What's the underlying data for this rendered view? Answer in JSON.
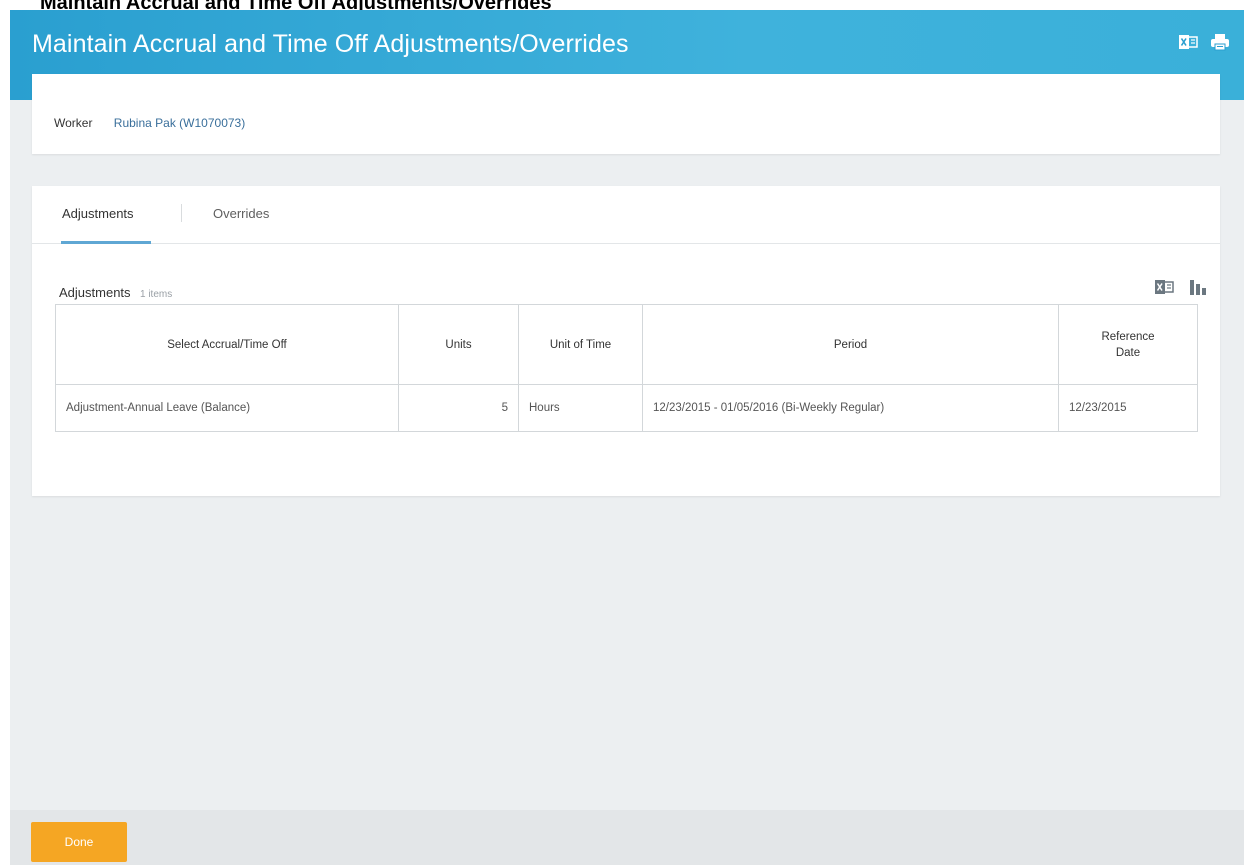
{
  "caption": "Maintain Accrual and Time Off Adjustments/Overrides",
  "header": {
    "title": "Maintain Accrual and Time Off Adjustments/Overrides",
    "icons": [
      "excel-export-icon",
      "print-icon"
    ],
    "band_color": "#3aaed9"
  },
  "worker": {
    "label": "Worker",
    "value": "Rubina Pak (W1070073)"
  },
  "tabs": [
    {
      "label": "Adjustments",
      "active": true
    },
    {
      "label": "Overrides",
      "active": false
    }
  ],
  "adjustments": {
    "title": "Adjustments",
    "count": "1 items",
    "tools": [
      "excel-export-icon",
      "chart-view-icon"
    ],
    "columns": [
      "Select Accrual/Time Off",
      "Units",
      "Unit of Time",
      "Period"
    ],
    "reference_col": {
      "line1": "Reference",
      "line2": "Date"
    },
    "rows": [
      {
        "accrual": "Adjustment-Annual Leave (Balance)",
        "units": "5",
        "unit_of_time": "Hours",
        "period": "12/23/2015 - 01/05/2016 (Bi-Weekly Regular)",
        "reference_date": "12/23/2015"
      }
    ]
  },
  "footer": {
    "done_label": "Done",
    "done_color": "#f5a623"
  }
}
